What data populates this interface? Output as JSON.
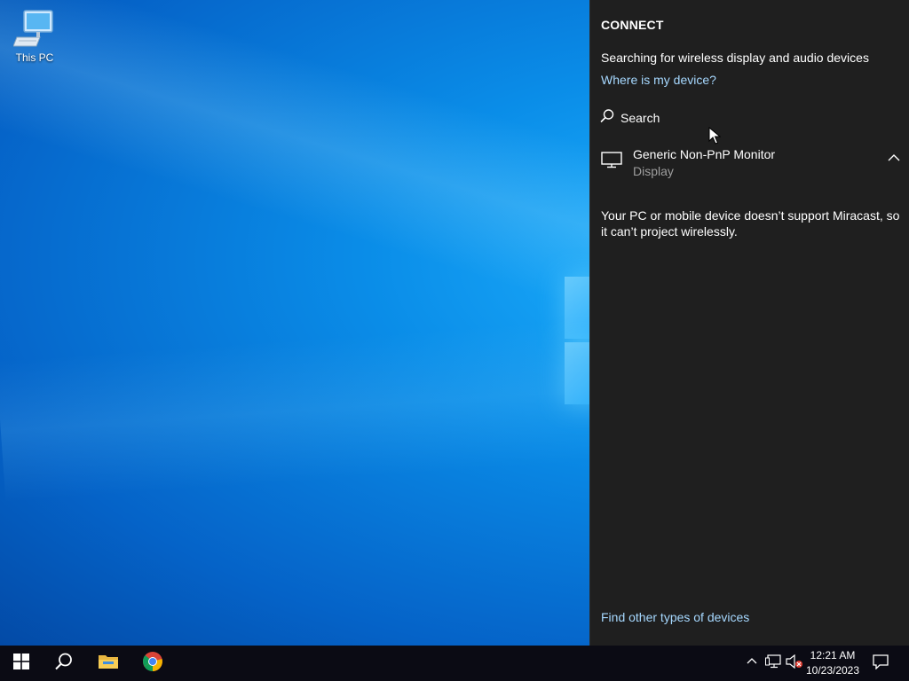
{
  "desktop": {
    "icons": [
      {
        "label": "This PC",
        "icon": "this-pc-icon"
      }
    ]
  },
  "connect": {
    "title": "CONNECT",
    "status": "Searching for wireless display and audio devices",
    "where_link": "Where is my device?",
    "search_label": "Search",
    "device": {
      "name": "Generic Non-PnP Monitor",
      "type": "Display",
      "icon": "monitor-icon",
      "expanded": true
    },
    "miracast_message": "Your PC or mobile device doesn’t support Miracast, so it can’t project wirelessly.",
    "find_other_link": "Find other types of devices"
  },
  "taskbar": {
    "pinned": [
      {
        "name": "start-button",
        "icon": "windows-logo-icon"
      },
      {
        "name": "search-button",
        "icon": "search-icon"
      },
      {
        "name": "file-explorer-button",
        "icon": "folder-icon"
      },
      {
        "name": "chrome-button",
        "icon": "chrome-icon"
      }
    ],
    "tray": {
      "icons": [
        "chevron-up-icon",
        "network-icon",
        "volume-muted-icon"
      ],
      "time": "12:21 AM",
      "date": "10/23/2023",
      "notification_icon": "notification-icon"
    }
  },
  "colors": {
    "panel_bg": "#1f1f1f",
    "link": "#a6d8ff",
    "taskbar_bg": "#0b0b14",
    "secondary_text": "#9e9e9e"
  }
}
